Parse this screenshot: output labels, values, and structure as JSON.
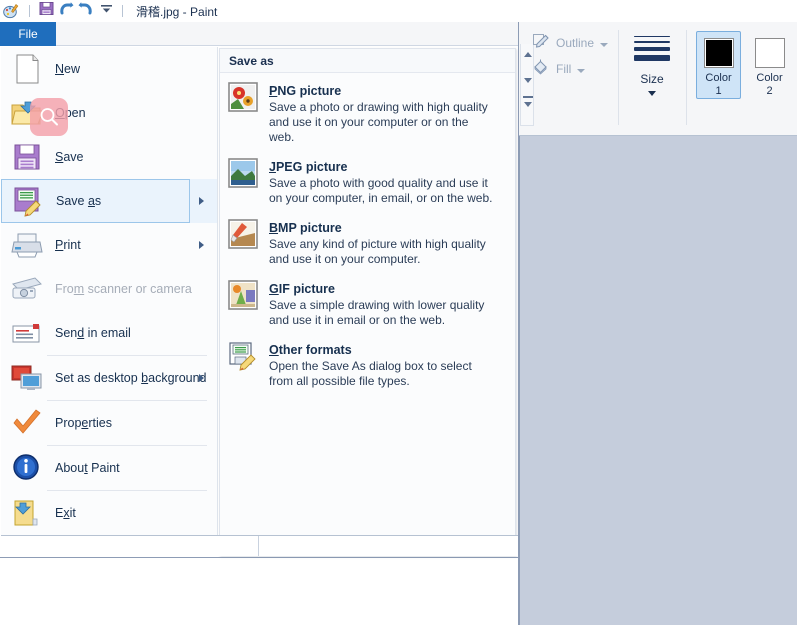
{
  "window": {
    "title": "滑稽.jpg - Paint",
    "quick_access": [
      {
        "name": "paint-app-icon",
        "label": "Paint"
      },
      {
        "name": "save-icon",
        "label": "Save"
      },
      {
        "name": "undo-icon",
        "label": "Undo"
      },
      {
        "name": "redo-icon",
        "label": "Redo"
      },
      {
        "name": "customize-quick-access-icon",
        "label": "Customize Quick Access Toolbar"
      }
    ]
  },
  "backstage": {
    "tab_label": "File",
    "items": [
      {
        "label": "New",
        "accel": "N",
        "icon": "new-document-icon",
        "arrow": false,
        "disabled": false,
        "divider_after": false
      },
      {
        "label": "Open",
        "accel": "O",
        "icon": "open-folder-icon",
        "arrow": false,
        "disabled": false,
        "divider_after": false
      },
      {
        "label": "Save",
        "accel": "S",
        "icon": "save-floppy-icon",
        "arrow": false,
        "disabled": false,
        "divider_after": false
      },
      {
        "label": "Save as",
        "accel": "a",
        "icon": "save-as-floppy-icon",
        "arrow": true,
        "disabled": false,
        "selected": true,
        "divider_after": false
      },
      {
        "label": "Print",
        "accel": "P",
        "icon": "printer-icon",
        "arrow": true,
        "disabled": false,
        "divider_after": false
      },
      {
        "label": "From scanner or camera",
        "accel": "m",
        "icon": "scanner-camera-icon",
        "arrow": false,
        "disabled": true,
        "divider_after": false
      },
      {
        "label": "Send in email",
        "accel": "d",
        "icon": "email-icon",
        "arrow": false,
        "disabled": false,
        "divider_after": true
      },
      {
        "label": "Set as desktop background",
        "accel": "b",
        "icon": "desktop-background-icon",
        "arrow": true,
        "disabled": false,
        "divider_after": true
      },
      {
        "label": "Properties",
        "accel": "e",
        "icon": "properties-checkmark-icon",
        "arrow": false,
        "disabled": false,
        "divider_after": true
      },
      {
        "label": "About Paint",
        "accel": "t",
        "icon": "about-info-icon",
        "arrow": false,
        "disabled": false,
        "divider_after": true
      },
      {
        "label": "Exit",
        "accel": "x",
        "icon": "exit-icon",
        "arrow": false,
        "disabled": false,
        "divider_after": false
      }
    ]
  },
  "submenu": {
    "title": "Save as",
    "items": [
      {
        "title": "PNG picture",
        "accel": "P",
        "icon": "png-flowers-icon",
        "description": "Save a photo or drawing with high quality and use it on your computer or on the web."
      },
      {
        "title": "JPEG picture",
        "accel": "J",
        "icon": "jpeg-landscape-icon",
        "description": "Save a photo with good quality and use it on your computer, in email, or on the web."
      },
      {
        "title": "BMP picture",
        "accel": "B",
        "icon": "bmp-brush-icon",
        "description": "Save any kind of picture with high quality and use it on your computer."
      },
      {
        "title": "GIF picture",
        "accel": "G",
        "icon": "gif-shapes-icon",
        "description": "Save a simple drawing with lower quality and use it in email or on the web."
      },
      {
        "title": "Other formats",
        "accel": "O",
        "icon": "other-formats-floppy-icon",
        "description": "Open the Save As dialog box to select from all possible file types."
      }
    ]
  },
  "ribbon": {
    "shapes_group": {
      "scroll_up": "scroll-up-arrow",
      "scroll_down": "scroll-down-arrow",
      "more": "more-shapes-arrow"
    },
    "outline": {
      "label": "Outline",
      "icon": "outline-pencil-icon",
      "disabled": true
    },
    "fill": {
      "label": "Fill",
      "icon": "fill-bucket-icon",
      "disabled": true
    },
    "size": {
      "label": "Size",
      "icon": "size-lines-icon"
    },
    "color1": {
      "label_line1": "Color",
      "label_line2": "1",
      "value": "#000000",
      "selected": true
    },
    "color2": {
      "label_line1": "Color",
      "label_line2": "2",
      "value": "#ffffff",
      "selected": false
    },
    "palette": [
      "#000000",
      "#7f7f7f",
      "#ffffff",
      "#c3c3c3",
      "#fafafa",
      "#fafafa"
    ]
  },
  "overlay": {
    "cursor": {
      "name": "zoom-magnifier-cursor",
      "color": "#f3a0aa"
    }
  },
  "theme": {
    "accent_blue": "#1f6ebd",
    "selection_blue": "#eaf3fc",
    "canvas_bg": "#c5cddc",
    "ribbon_bg": "#f5f6f8"
  }
}
